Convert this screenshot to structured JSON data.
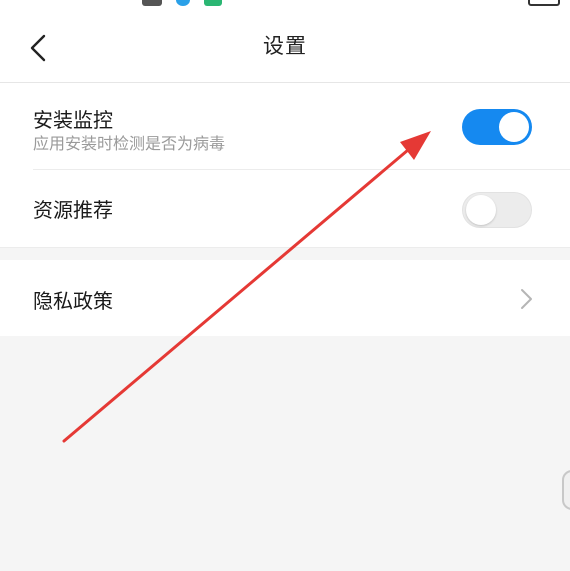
{
  "header": {
    "title": "设置",
    "back_icon": "chevron-left-icon"
  },
  "settings": {
    "install_monitor": {
      "title": "安装监控",
      "subtitle": "应用安装时检测是否为病毒",
      "enabled": true
    },
    "resource_recommend": {
      "title": "资源推荐",
      "enabled": false
    },
    "privacy_policy": {
      "title": "隐私政策",
      "chevron_icon": "chevron-right-icon"
    }
  },
  "colors": {
    "toggle_on": "#1589f0",
    "toggle_off": "#ececec",
    "annotation_arrow": "#e53935",
    "background": "#f5f5f5"
  }
}
